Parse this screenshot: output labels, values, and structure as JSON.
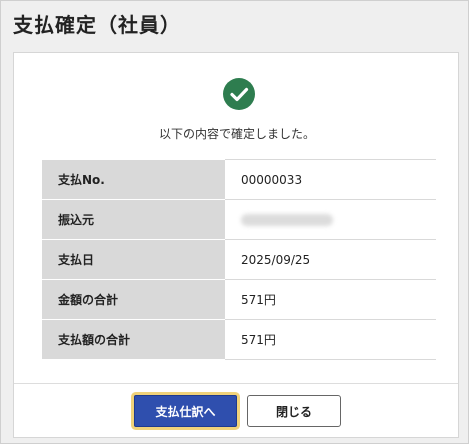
{
  "dialog": {
    "title": "支払確定（社員）",
    "message": "以下の内容で確定しました。",
    "details": [
      {
        "label": "支払No.",
        "value": "00000033"
      },
      {
        "label": "振込元",
        "value": "",
        "redacted": true
      },
      {
        "label": "支払日",
        "value": "2025/09/25"
      },
      {
        "label": "金額の合計",
        "value": "571円"
      },
      {
        "label": "支払額の合計",
        "value": "571円"
      }
    ],
    "buttons": {
      "journal": "支払仕訳へ",
      "close": "閉じる"
    }
  },
  "colors": {
    "success": "#2e7d4f",
    "primary": "#2f4fae",
    "focus_ring": "#f0d27a"
  },
  "icons": {
    "status": "check-circle-icon"
  }
}
